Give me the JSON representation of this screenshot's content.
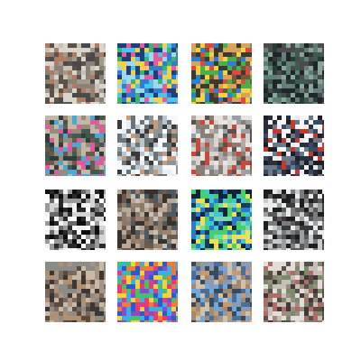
{
  "grid": {
    "rows": 4,
    "cols": 4,
    "background": "#ffffff",
    "tiles": [
      {
        "palette": [
          "#8a8276",
          "#a39a8c",
          "#c7c2b8",
          "#5c5248",
          "#b07b62",
          "#d9d4cc",
          "#4a4a4a"
        ]
      },
      {
        "palette": [
          "#2f7fd1",
          "#4fc3e8",
          "#f2d04a",
          "#3fb36b",
          "#e85a9b",
          "#1e3f7a",
          "#9fd7ef"
        ]
      },
      {
        "palette": [
          "#3a3a2e",
          "#e2463c",
          "#f2d43e",
          "#46b04a",
          "#2c7fd6",
          "#d9a35c",
          "#6d5a3e"
        ]
      },
      {
        "palette": [
          "#2a3a3a",
          "#3e5a55",
          "#5e7f73",
          "#1f2626",
          "#8aa59c",
          "#4b4c48",
          "#6b7d80"
        ]
      },
      {
        "palette": [
          "#3f5a4e",
          "#9a8a7a",
          "#e05aa0",
          "#49a8d8",
          "#6b5a4a",
          "#c2b8a8",
          "#2f3e3a"
        ]
      },
      {
        "palette": [
          "#e8eef2",
          "#b9c6cf",
          "#6c7478",
          "#3a3a3a",
          "#c89c7a",
          "#f7f9fa",
          "#8c9498"
        ]
      },
      {
        "palette": [
          "#b4aca4",
          "#d9d4cf",
          "#8a7f76",
          "#c84a3e",
          "#5a524c",
          "#e8e4df",
          "#9aa0a6"
        ]
      },
      {
        "palette": [
          "#1e1e24",
          "#e8ecef",
          "#3a4a66",
          "#c23a2e",
          "#6a7a8a",
          "#f5f5f5",
          "#2a2f3a"
        ]
      },
      {
        "palette": [
          "#ffffff",
          "#2a2a2a",
          "#f2f2f2",
          "#6a6a6a",
          "#d4d4d4",
          "#0e0e0e",
          "#9a9a9a"
        ]
      },
      {
        "palette": [
          "#6d5a4e",
          "#b8a898",
          "#3a322c",
          "#8a7a6a",
          "#c5c0b8",
          "#4c5a64",
          "#9c8270"
        ]
      },
      {
        "palette": [
          "#1b3a5a",
          "#3fc7d9",
          "#46d06a",
          "#2a7ad1",
          "#f0e050",
          "#0f2438",
          "#7ad9b0"
        ]
      },
      {
        "palette": [
          "#e9ebed",
          "#3a3a3a",
          "#9aa0a4",
          "#5c5a58",
          "#c9cbcd",
          "#1e1e1e",
          "#7a7c7e"
        ]
      },
      {
        "palette": [
          "#7a6a5e",
          "#a89484",
          "#5a4a40",
          "#c8b8a6",
          "#3e3630",
          "#8e8a86",
          "#b09070"
        ]
      },
      {
        "palette": [
          "#e83a7a",
          "#3ab0e0",
          "#f2d43a",
          "#46c06a",
          "#8a4ad0",
          "#f07a3a",
          "#2a5ad0"
        ]
      },
      {
        "palette": [
          "#6ea8dc",
          "#4a6f9a",
          "#a08a74",
          "#d2c0a8",
          "#3a4a5a",
          "#8a9ab0",
          "#c89a6a"
        ]
      },
      {
        "palette": [
          "#9a8e82",
          "#c8c0b6",
          "#5a504a",
          "#7a8a6a",
          "#b06a6a",
          "#e2ddd6",
          "#3e3a36"
        ]
      }
    ]
  }
}
